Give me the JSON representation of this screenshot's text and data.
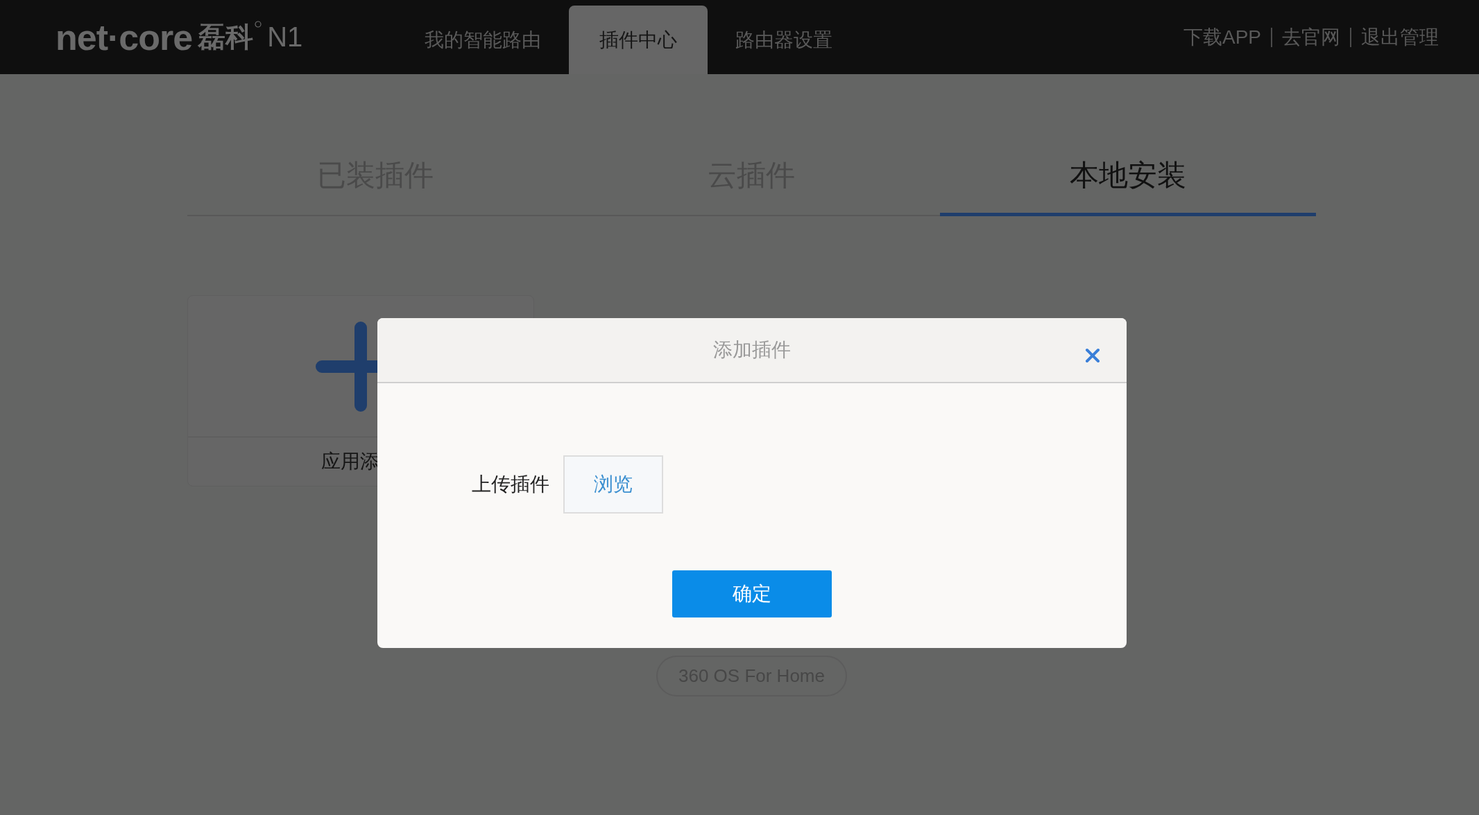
{
  "header": {
    "logo": {
      "brand": "net·core",
      "brand_cn": "磊科",
      "model": "N1"
    },
    "nav_tabs": [
      {
        "label": "我的智能路由",
        "selected": false
      },
      {
        "label": "插件中心",
        "selected": true
      },
      {
        "label": "路由器设置",
        "selected": false
      }
    ],
    "links": [
      "下载APP",
      "去官网",
      "退出管理"
    ]
  },
  "subtabs": [
    {
      "label": "已装插件",
      "selected": false
    },
    {
      "label": "云插件",
      "selected": false
    },
    {
      "label": "本地安装",
      "selected": true
    }
  ],
  "card": {
    "label": "应用添"
  },
  "modal": {
    "title": "添加插件",
    "field_label": "上传插件",
    "browse_button": "浏览",
    "confirm_button": "确定"
  },
  "footer": {
    "badge": "360 OS For Home"
  }
}
